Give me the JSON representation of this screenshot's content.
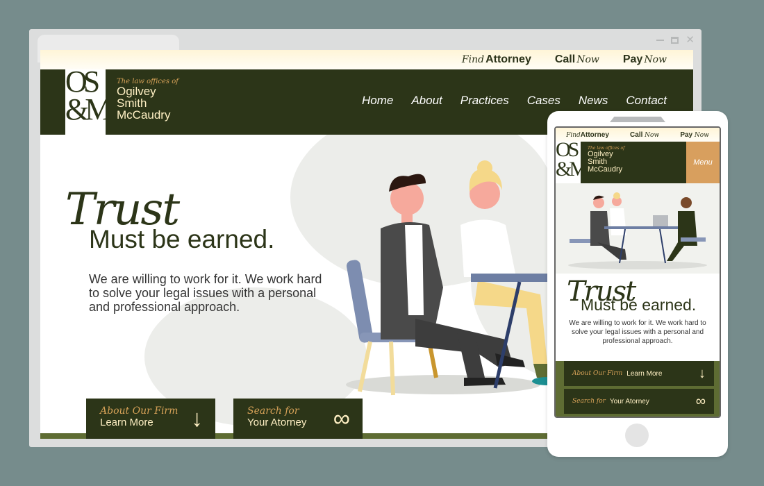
{
  "brand": {
    "monogram_line1": "OS",
    "monogram_line2": "&M",
    "tagline": "The law offices of",
    "name_lines": [
      "Ogilvey",
      "Smith",
      "McCaudry"
    ]
  },
  "topbar": {
    "find": {
      "script": "Find",
      "label": "Attorney"
    },
    "call": {
      "label": "Call",
      "script": "Now"
    },
    "pay": {
      "label": "Pay",
      "script": "Now"
    }
  },
  "nav": {
    "items": [
      "Home",
      "About",
      "Practices",
      "Cases",
      "News",
      "Contact"
    ],
    "mobile_menu_label": "Menu"
  },
  "hero": {
    "script_title": "Trust",
    "title": "Must be earned.",
    "description": "We are willing to work for it.  We work hard to solve your legal issues with a personal and professional approach."
  },
  "ctas": [
    {
      "script": "About Our Firm",
      "label": "Learn More",
      "icon": "arrow-down-icon",
      "glyph": "↓"
    },
    {
      "script": "Search for",
      "label": "Your Atorney",
      "icon": "binoculars-icon",
      "glyph": "∞"
    }
  ],
  "window_controls": [
    "minimize",
    "maximize",
    "close"
  ],
  "colors": {
    "brand_dark_green": "#2c3518",
    "gold": "#d7a258",
    "cream": "#fff0c4",
    "menu_orange": "#d89f5e",
    "olive": "#5e6c33",
    "backdrop": "#768c8c"
  }
}
